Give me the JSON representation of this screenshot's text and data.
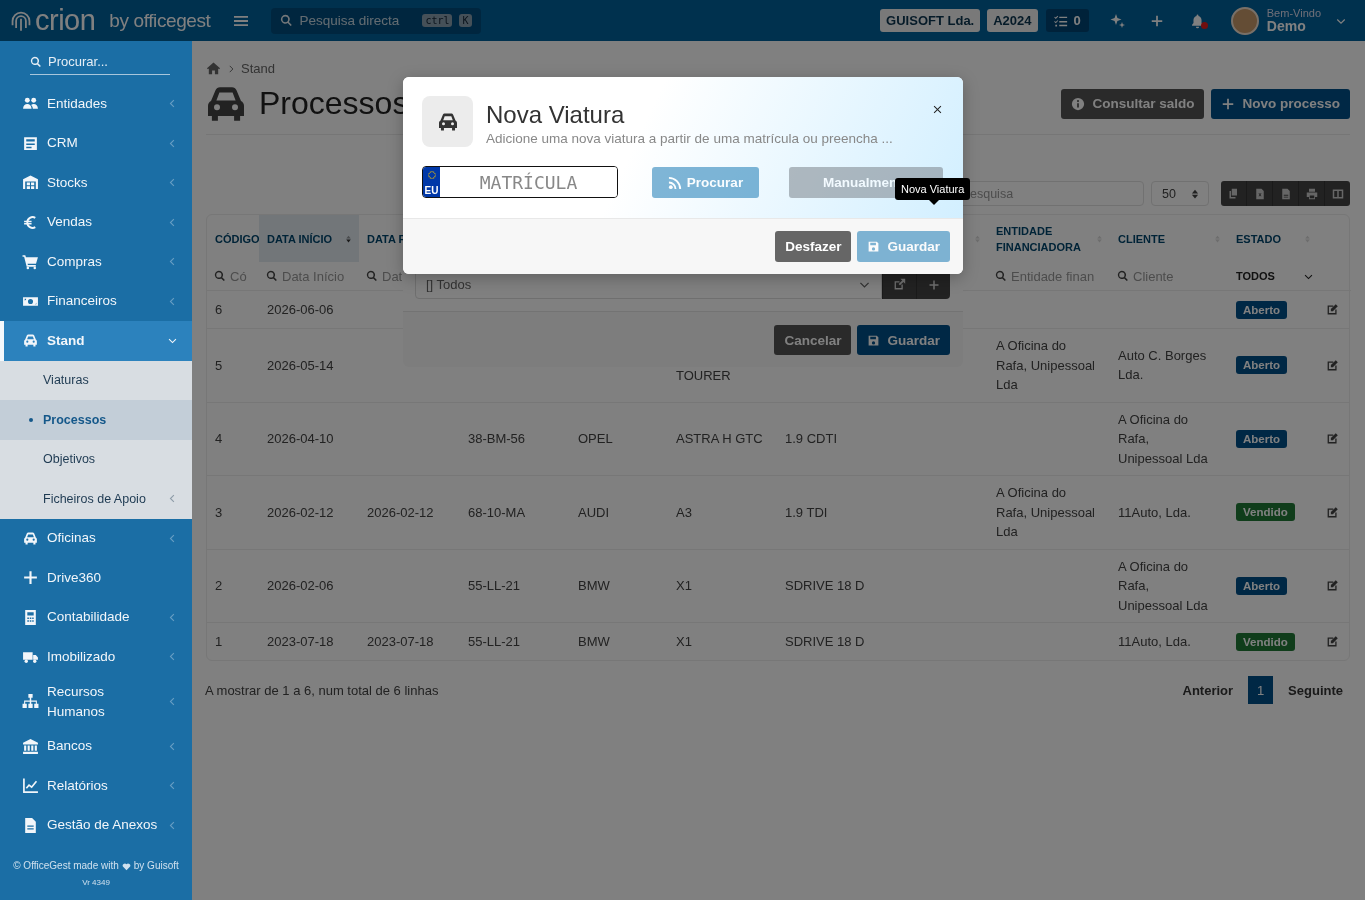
{
  "topbar": {
    "logo": "crion",
    "logo_suffix": "by officegest",
    "search": {
      "placeholder": "Pesquisa directa",
      "keys": [
        "ctrl",
        "K"
      ]
    },
    "company": "GUISOFT Lda.",
    "year": "A2024",
    "tasks_count": "0",
    "notifications_unread": true,
    "user": {
      "greeting": "Bem-Vindo",
      "name": "Demo"
    }
  },
  "sidebar": {
    "search": {
      "placeholder": "Procurar..."
    },
    "items": [
      {
        "label": "Entidades",
        "kind": "group",
        "expanded": false,
        "selected": false
      },
      {
        "label": "CRM",
        "kind": "group",
        "expanded": false,
        "selected": false
      },
      {
        "label": "Stocks",
        "kind": "group",
        "expanded": false,
        "selected": false
      },
      {
        "label": "Vendas",
        "kind": "group",
        "expanded": false,
        "selected": false
      },
      {
        "label": "Compras",
        "kind": "group",
        "expanded": false,
        "selected": false
      },
      {
        "label": "Financeiros",
        "kind": "group",
        "expanded": false,
        "selected": false
      },
      {
        "label": "Stand",
        "kind": "group",
        "expanded": true,
        "selected": true,
        "children": [
          {
            "label": "Viaturas",
            "kind": "link",
            "selected": false
          },
          {
            "label": "Processos",
            "kind": "link",
            "selected": true
          },
          {
            "label": "Objetivos",
            "kind": "link",
            "selected": false
          },
          {
            "label": "Ficheiros de Apoio",
            "kind": "group",
            "expanded": false,
            "selected": false
          }
        ]
      },
      {
        "label": "Oficinas",
        "kind": "group",
        "expanded": false,
        "selected": false
      },
      {
        "label": "Drive360",
        "kind": "link",
        "selected": false
      },
      {
        "label": "Contabilidade",
        "kind": "group",
        "expanded": false,
        "selected": false
      },
      {
        "label": "Imobilizado",
        "kind": "group",
        "expanded": false,
        "selected": false
      },
      {
        "label": "Recursos Humanos",
        "kind": "group",
        "expanded": false,
        "selected": false
      },
      {
        "label": "Bancos",
        "kind": "group",
        "expanded": false,
        "selected": false
      },
      {
        "label": "Relatórios",
        "kind": "group",
        "expanded": false,
        "selected": false
      },
      {
        "label": "Gestão de Anexos",
        "kind": "group",
        "expanded": false,
        "selected": false
      }
    ],
    "footer": {
      "credit_before": "© OfficeGest made with",
      "credit_after": "by Guisoft",
      "version": "Vr 4349"
    }
  },
  "page": {
    "breadcrumb": [
      "Stand"
    ],
    "title": "Processos",
    "actions": [
      {
        "label": "Consultar saldo",
        "kind": "secondary"
      },
      {
        "label": "Novo processo",
        "kind": "primary"
      }
    ],
    "table": {
      "search": {
        "placeholder": "esquisa"
      },
      "page_size": "50",
      "columns": [
        {
          "label": "CÓDIGO",
          "filter": {
            "kind": "search",
            "placeholder": "Có"
          }
        },
        {
          "label": "DATA INÍCIO",
          "sorted": true,
          "filter": {
            "kind": "search",
            "placeholder": "Data Início"
          }
        },
        {
          "label": "DATA F",
          "filter": {
            "kind": "search",
            "placeholder": "Dat"
          }
        },
        {},
        {},
        {},
        {
          "sorted": false
        },
        {
          "label": "ENTIDADE FINANCIADORA",
          "sorted": false,
          "filter": {
            "kind": "search",
            "placeholder": "Entidade finan"
          }
        },
        {
          "label": "CLIENTE",
          "sorted": false,
          "filter": {
            "kind": "search",
            "placeholder": "Cliente"
          }
        },
        {
          "label": "ESTADO",
          "sorted": false,
          "filter": {
            "kind": "select",
            "value": "TODOS"
          }
        },
        {}
      ],
      "rows": [
        {
          "cells": [
            "6",
            "2026-06-06",
            null,
            null,
            null,
            null,
            null,
            null,
            null
          ],
          "status": {
            "label": "Aberto",
            "kind": "open"
          }
        },
        {
          "cells": [
            "5",
            "2026-05-14",
            null,
            null,
            null,
            {
              "text": "TOURER",
              "kind": "line_tail"
            },
            null,
            "A Oficina do Rafa, Unipessoal Lda",
            "Auto C. Borges Lda."
          ],
          "status": {
            "label": "Aberto",
            "kind": "open"
          }
        },
        {
          "cells": [
            "4",
            "2026-04-10",
            null,
            "38-BM-56",
            "OPEL",
            "ASTRA H GTC",
            "1.9 CDTI",
            null,
            "A Oficina do Rafa, Unipessoal Lda"
          ],
          "status": {
            "label": "Aberto",
            "kind": "open"
          }
        },
        {
          "cells": [
            "3",
            "2026-02-12",
            "2026-02-12",
            "68-10-MA",
            "AUDI",
            "A3",
            "1.9 TDI",
            "A Oficina do Rafa, Unipessoal Lda",
            "11Auto, Lda."
          ],
          "status": {
            "label": "Vendido",
            "kind": "sold"
          }
        },
        {
          "cells": [
            "2",
            "2026-02-06",
            null,
            "55-LL-21",
            "BMW",
            "X1",
            "SDRIVE 18 D",
            null,
            "A Oficina do Rafa, Unipessoal Lda"
          ],
          "status": {
            "label": "Aberto",
            "kind": "open"
          }
        },
        {
          "cells": [
            "1",
            "2023-07-18",
            "2023-07-18",
            "55-LL-21",
            "BMW",
            "X1",
            "SDRIVE 18 D",
            null,
            "11Auto, Lda."
          ],
          "status": {
            "label": "Vendido",
            "kind": "sold"
          }
        }
      ]
    },
    "pagination": {
      "summary": "A mostrar de 1 a 6, num total de 6 linhas",
      "previous": "Anterior",
      "pages": [
        {
          "label": "1",
          "selected": true
        }
      ],
      "next": "Seguinte"
    }
  },
  "back_modal": {
    "select": {
      "value": "[] Todos"
    },
    "buttons": [
      {
        "label": "Cancelar",
        "kind": "secondary"
      },
      {
        "label": "Guardar",
        "kind": "primary"
      }
    ]
  },
  "modal": {
    "title": "Nova Viatura",
    "subtitle": "Adicione uma nova viatura a partir de uma matrícula ou preencha ...",
    "plate": {
      "country": "EU",
      "placeholder": "MATRÍCULA"
    },
    "actions": [
      {
        "label": "Procurar",
        "kind": "search",
        "disabled": true
      },
      {
        "label": "Manualmen",
        "kind": "manual",
        "disabled": true
      }
    ],
    "footer_buttons": [
      {
        "label": "Desfazer",
        "kind": "secondary",
        "disabled": false
      },
      {
        "label": "Guardar",
        "kind": "primary",
        "disabled": true
      }
    ],
    "tooltip": "Nova Viatura"
  }
}
